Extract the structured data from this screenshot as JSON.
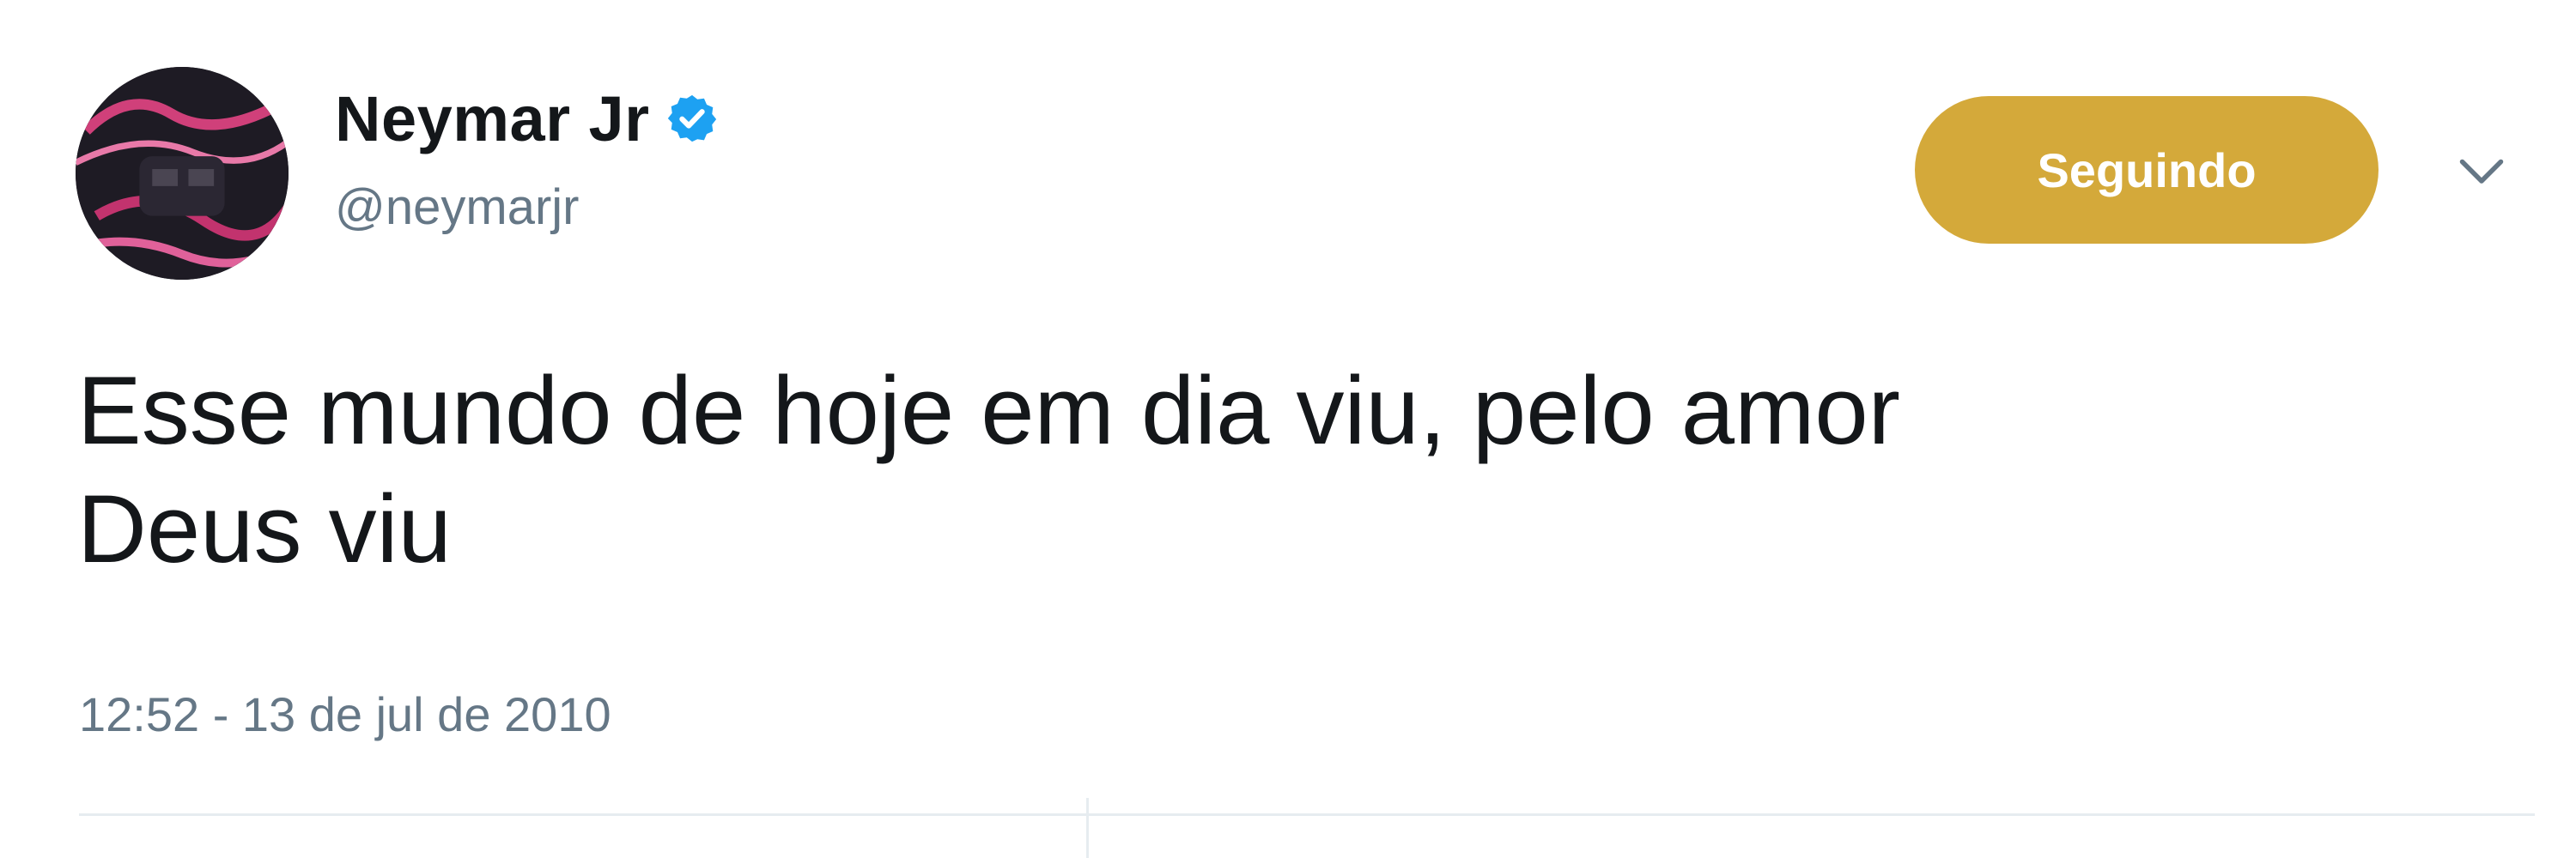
{
  "tweet": {
    "author": {
      "display_name": "Neymar Jr",
      "handle": "@neymarjr",
      "verified": true,
      "avatar_icon": "profile-avatar"
    },
    "follow_button_label": "Seguindo",
    "menu_icon": "chevron-down-icon",
    "text": "Esse mundo de hoje em dia viu, pelo amor\nDeus viu",
    "timestamp": "12:52 - 13 de jul de 2010"
  },
  "colors": {
    "follow_button": "#d4a93a",
    "verified_badge": "#1da1f2",
    "secondary_text": "#657786",
    "primary_text": "#14171a"
  }
}
